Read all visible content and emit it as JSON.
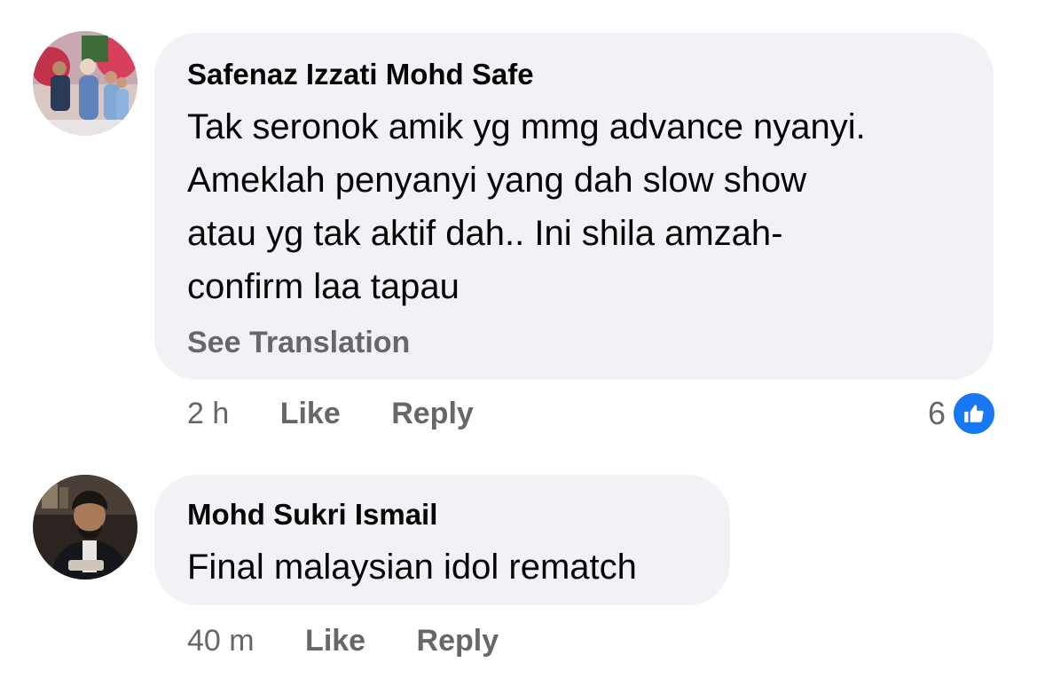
{
  "comments": [
    {
      "author": "Safenaz Izzati Mohd Safe",
      "text_lines": [
        "Tak seronok amik yg mmg advance nyanyi.",
        "Ameklah penyanyi yang dah slow show",
        "atau yg tak aktif dah.. Ini shila amzah-",
        "confirm laa tapau"
      ],
      "see_translation": "See Translation",
      "time": "2 h",
      "like_label": "Like",
      "reply_label": "Reply",
      "reaction_count": "6",
      "reaction_icon": "like-thumbs-up-icon"
    },
    {
      "author": "Mohd Sukri Ismail",
      "text_lines": [
        "Final malaysian idol rematch"
      ],
      "time": "40 m",
      "like_label": "Like",
      "reply_label": "Reply"
    }
  ],
  "colors": {
    "bubble_bg": "#f0f2f5",
    "secondary_text": "#65676b",
    "primary_text": "#050505",
    "like_blue": "#1877f2"
  }
}
